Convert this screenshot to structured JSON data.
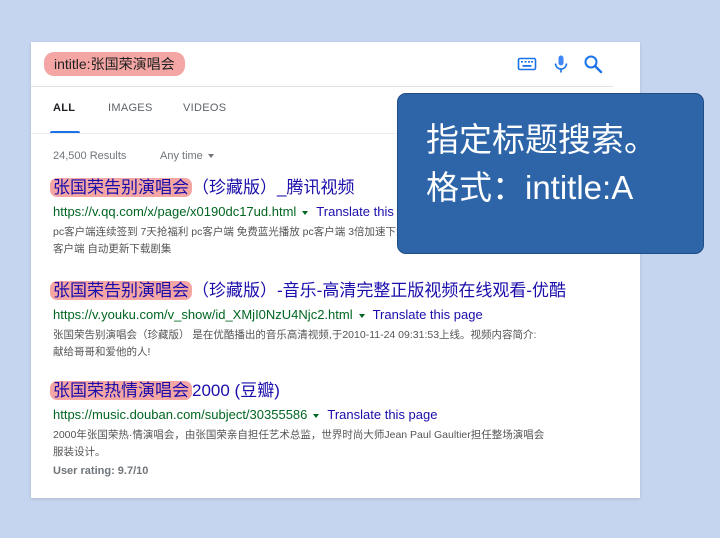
{
  "search": {
    "query": "intitle:张国荣演唱会",
    "icons": [
      "keyboard-icon",
      "microphone-icon",
      "search-icon"
    ]
  },
  "tabs": [
    {
      "label": "ALL",
      "active": true
    },
    {
      "label": "IMAGES",
      "active": false
    },
    {
      "label": "VIDEOS",
      "active": false
    }
  ],
  "stats": {
    "count": "24,500 Results",
    "filter": "Any time"
  },
  "results": [
    {
      "title_hl": "张国荣告别演唱会",
      "title_rest": "（珍藏版）_腾讯视频",
      "url": "https://v.qq.com/x/page/x0190dc17ud.html",
      "translate": "Translate this page",
      "snippet": [
        "pc客户端连续签到 7天抢福利 pc客户端 免费蓝光播放 pc客户端 3倍加速下载 pc",
        "客户端 自动更新下载剧集"
      ]
    },
    {
      "title_hl": "张国荣告别演唱会",
      "title_rest": "（珍藏版）-音乐-高清完整正版视频在线观看-优酷",
      "url": "https://v.youku.com/v_show/id_XMjI0NzU4Njc2.html",
      "translate": "Translate this page",
      "snippet": [
        "张国荣告别演唱会（珍藏版） 是在优酷播出的音乐高清视频,于2010-11-24 09:31:53上线。视频内容简介:",
        "献给哥哥和爱他的人!"
      ]
    },
    {
      "title_hl": "张国荣热情演唱会",
      "title_rest": "2000 (豆瓣)",
      "url": "https://music.douban.com/subject/30355586",
      "translate": "Translate this page",
      "snippet": [
        "2000年张国荣热·情演唱会，由张国荣亲自担任艺术总监，世界时尚大师Jean Paul Gaultier担任整场演唱会",
        "服装设计。"
      ],
      "rating": "User rating: 9.7/10"
    }
  ],
  "callout": {
    "line1": "指定标题搜索。",
    "line2": "格式：intitle:A"
  },
  "colors": {
    "background": "#c5d4ef",
    "highlight": "#f4a6a4",
    "callout": "#2d65a8",
    "link": "#1a0dab",
    "url": "#006621",
    "accent": "#1a73e8"
  }
}
